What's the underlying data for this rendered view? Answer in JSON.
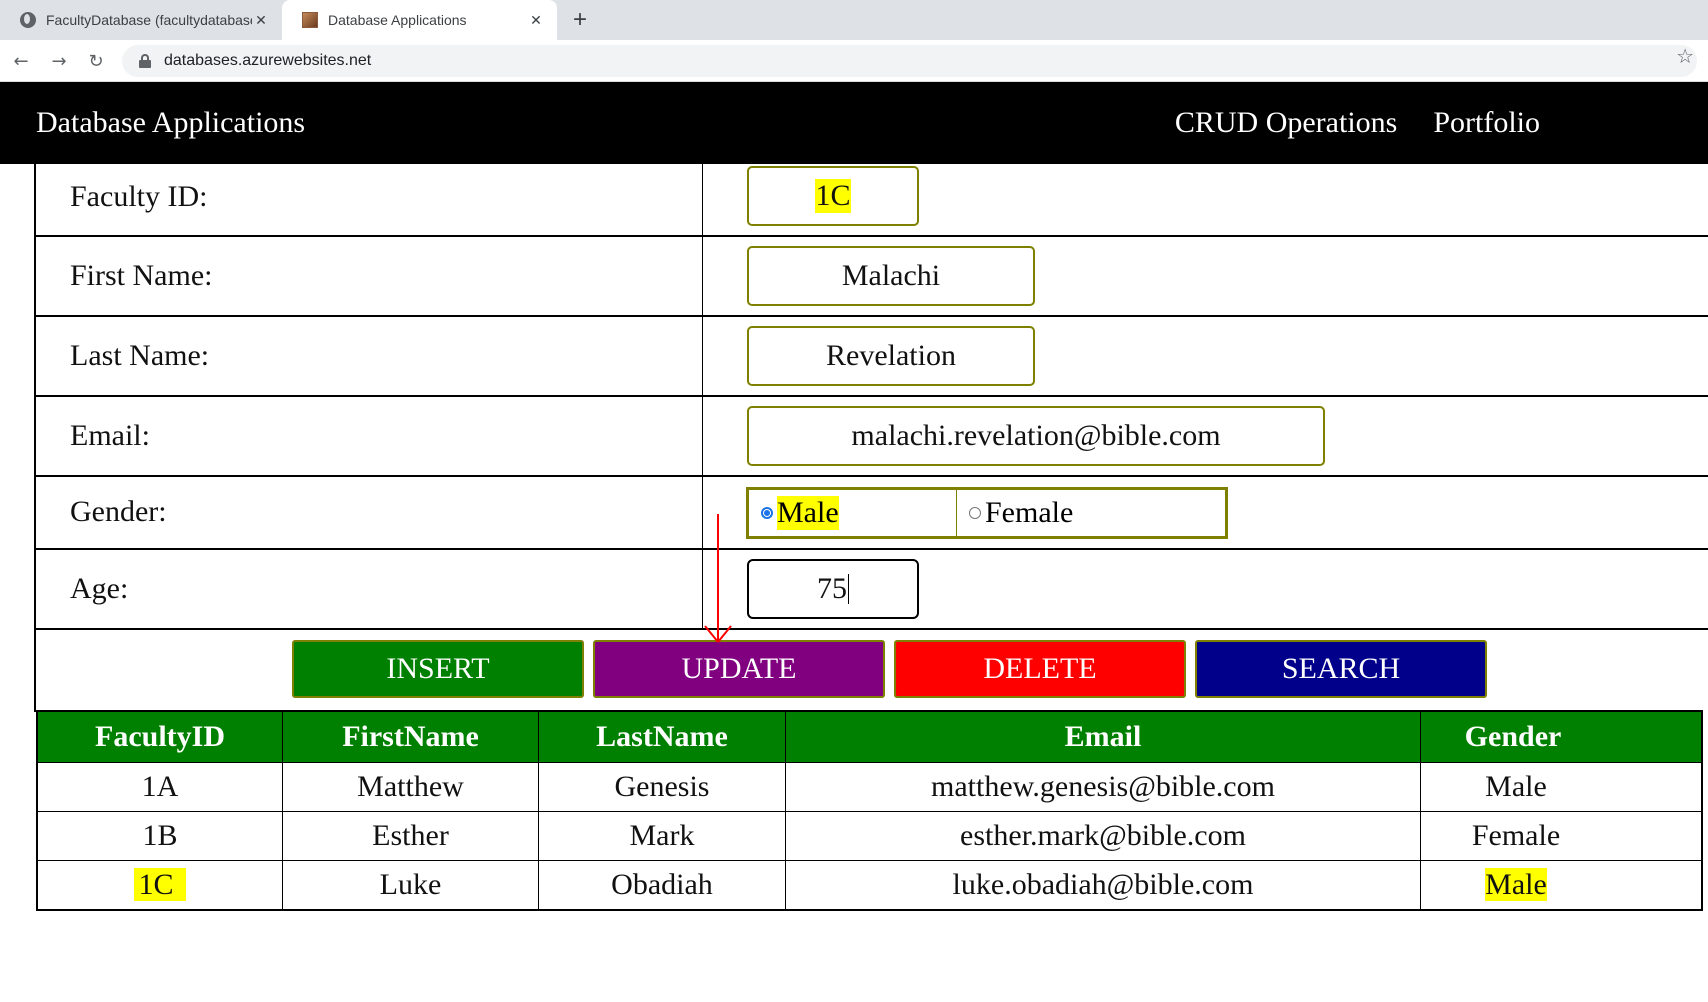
{
  "browser": {
    "tabs": [
      {
        "title": "FacultyDatabase (facultydatabase",
        "active": false,
        "icon": "globe-icon"
      },
      {
        "title": "Database Applications",
        "active": true,
        "icon": "portrait-favicon"
      }
    ],
    "new_tab_label": "+",
    "close_label": "✕",
    "url": "databases.azurewebsites.net"
  },
  "site": {
    "brand": "Database Applications",
    "nav": [
      "CRUD Operations",
      "Portfolio"
    ]
  },
  "form": {
    "faculty_id": {
      "label": "Faculty ID:",
      "value": "1C"
    },
    "first_name": {
      "label": "First Name:",
      "value": "Malachi"
    },
    "last_name": {
      "label": "Last Name:",
      "value": "Revelation"
    },
    "email": {
      "label": "Email:",
      "value": "malachi.revelation@bible.com"
    },
    "gender": {
      "label": "Gender:",
      "options": [
        "Male",
        "Female"
      ],
      "selected": "Male"
    },
    "age": {
      "label": "Age:",
      "value": "75"
    }
  },
  "buttons": {
    "insert": {
      "label": "INSERT",
      "color": "#008000"
    },
    "update": {
      "label": "UPDATE",
      "color": "#800080"
    },
    "delete": {
      "label": "DELETE",
      "color": "#ff0000"
    },
    "search": {
      "label": "SEARCH",
      "color": "#00008b"
    }
  },
  "table": {
    "headers": [
      "FacultyID",
      "FirstName",
      "LastName",
      "Email",
      "Gender"
    ],
    "rows": [
      [
        "1A",
        "Matthew",
        "Genesis",
        "matthew.genesis@bible.com",
        "Male"
      ],
      [
        "1B",
        "Esther",
        "Mark",
        "esther.mark@bible.com",
        "Female"
      ],
      [
        "1C",
        "Luke",
        "Obadiah",
        "luke.obadiah@bible.com",
        "Male"
      ]
    ]
  },
  "colors": {
    "header_bg": "#000000",
    "table_header_bg": "#008000",
    "highlight": "#ffff00",
    "field_border": "#7f7f00",
    "annotation": "#ff0000"
  }
}
